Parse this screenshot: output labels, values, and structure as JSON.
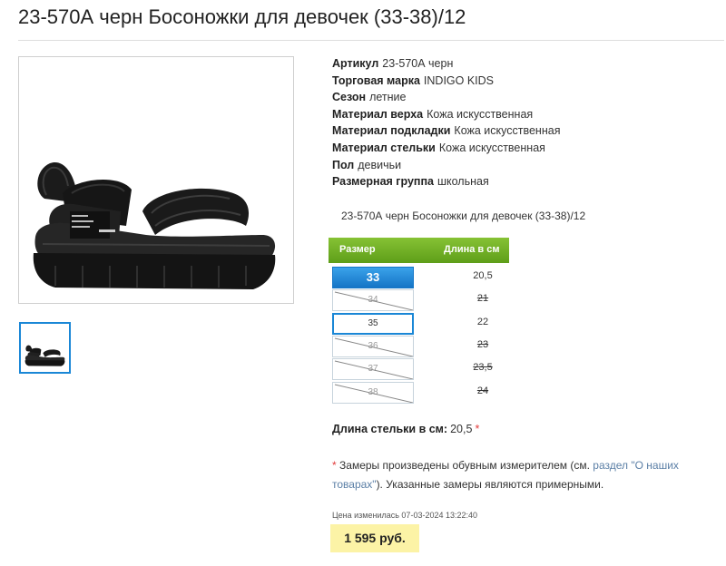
{
  "product": {
    "title": "23-570А черн Босоножки для девочек (33-38)/12",
    "subtitle": "23-570А черн Босоножки для девочек (33-38)/12",
    "image_icon": "sandal-image",
    "thumbnail_icon": "sandal-thumbnail"
  },
  "specs": [
    {
      "key": "Артикул",
      "value": "23-570А черн"
    },
    {
      "key": "Торговая марка",
      "value": "INDIGO KIDS"
    },
    {
      "key": "Сезон",
      "value": "летние"
    },
    {
      "key": "Материал верха",
      "value": "Кожа искусственная"
    },
    {
      "key": "Материал подкладки",
      "value": "Кожа искусственная"
    },
    {
      "key": "Материал стельки",
      "value": "Кожа искусственная"
    },
    {
      "key": "Пол",
      "value": "девичьи"
    },
    {
      "key": "Размерная группа",
      "value": "школьная"
    }
  ],
  "size_table": {
    "header_size": "Размер",
    "header_length": "Длина в см",
    "accent_color": "#6aaa22",
    "rows": [
      {
        "size": "33",
        "length": "20,5",
        "state": "active"
      },
      {
        "size": "34",
        "length": "21",
        "state": "unavailable"
      },
      {
        "size": "35",
        "length": "22",
        "state": "selected"
      },
      {
        "size": "36",
        "length": "23",
        "state": "unavailable"
      },
      {
        "size": "37",
        "length": "23,5",
        "state": "unavailable"
      },
      {
        "size": "38",
        "length": "24",
        "state": "unavailable"
      }
    ]
  },
  "insole": {
    "label": "Длина стельки в см:",
    "value": "20,5",
    "star": "*"
  },
  "note": {
    "star": "*",
    "text1": "Замеры произведены обувным измерителем (см.",
    "link": "раздел \"О наших товарах\"",
    "text2": "). Указанные замеры являются примерными."
  },
  "price": {
    "changed_label": "Цена изменилась 07-03-2024 13:22:40",
    "value": "1 595 руб.",
    "highlight_color": "#fcf3a6"
  }
}
